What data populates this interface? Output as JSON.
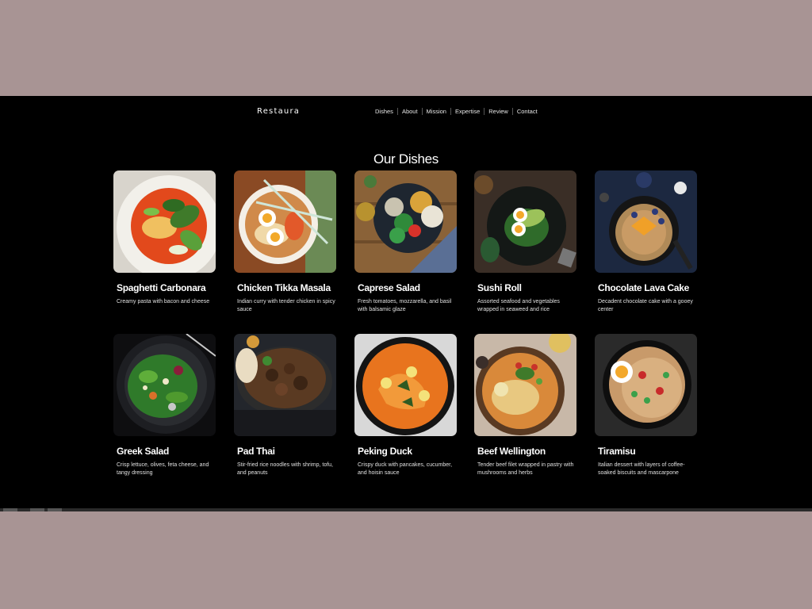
{
  "brand": "Restaura",
  "nav": [
    "Dishes",
    "About",
    "Mission",
    "Expertise",
    "Review",
    "Contact"
  ],
  "section_title": "Our Dishes",
  "dishes": [
    {
      "name": "Spaghetti Carbonara",
      "description": "Creamy pasta with bacon and cheese",
      "image": "curry-noodle-bowl-image"
    },
    {
      "name": "Chicken Tikka Masala",
      "description": "Indian curry with tender chicken in spicy sauce",
      "image": "ramen-bowl-image"
    },
    {
      "name": "Caprese Salad",
      "description": "Fresh tomatoes, mozzarella, and basil with balsamic glaze",
      "image": "salad-bowl-image"
    },
    {
      "name": "Sushi Roll",
      "description": "Assorted seafood and vegetables wrapped in seaweed and rice",
      "image": "egg-avocado-plate-image"
    },
    {
      "name": "Chocolate Lava Cake",
      "description": "Decadent chocolate cake with a gooey center",
      "image": "oatmeal-bowl-image"
    },
    {
      "name": "Greek Salad",
      "description": "Crisp lettuce, olives, feta cheese, and tangy dressing",
      "image": "green-salad-image"
    },
    {
      "name": "Pad Thai",
      "description": "Stir-fried rice noodles with shrimp, tofu, and peanuts",
      "image": "beef-stir-fry-image"
    },
    {
      "name": "Peking Duck",
      "description": "Crispy duck with pancakes, cucumber, and hoisin sauce",
      "image": "salmon-curry-image"
    },
    {
      "name": "Beef Wellington",
      "description": "Tender beef filet wrapped in pastry with mushrooms and herbs",
      "image": "noodle-soup-image"
    },
    {
      "name": "Tiramisu",
      "description": "Italian dessert with layers of coffee-soaked biscuits and mascarpone",
      "image": "ramen-egg-image"
    }
  ],
  "colors": {
    "page_background": "#a89494",
    "screen_background": "#000000",
    "text": "#ffffff"
  }
}
